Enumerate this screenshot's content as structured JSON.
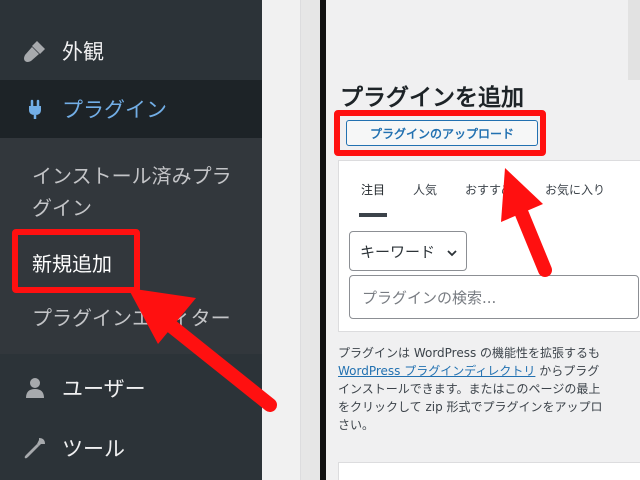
{
  "sidebar": {
    "appearance": {
      "label": "外観",
      "icon": "paintbrush-icon"
    },
    "plugins": {
      "label": "プラグイン",
      "icon": "plugin-plug-icon"
    },
    "submenu": {
      "installed": "インストール済みプラグイン",
      "add_new": "新規追加",
      "editor": "プラグインエディター"
    },
    "users": {
      "label": "ユーザー",
      "icon": "user-icon"
    },
    "tools": {
      "label": "ツール",
      "icon": "wrench-icon"
    }
  },
  "main": {
    "title": "プラグインを追加",
    "upload_button": "プラグインのアップロード",
    "tabs": [
      "注目",
      "人気",
      "おすすめ",
      "お気に入り"
    ],
    "search": {
      "type_select": "キーワード",
      "placeholder": "プラグインの検索..."
    },
    "description": {
      "line1": "プラグインは WordPress の機能性を拡張するも",
      "link": "WordPress プラグインディレクトリ",
      "line2_tail": " からプラグ",
      "line3": "インストールできます。またはこのページの最上",
      "line4": "をクリックして zip 形式でプラグインをアップロ",
      "line5": "さい。"
    }
  },
  "colors": {
    "sidebar_bg": "#2c3338",
    "sidebar_active_bg": "#1d2327",
    "accent_blue": "#72aee6",
    "link_blue": "#2271b1",
    "annotation_red": "#ff1010"
  }
}
